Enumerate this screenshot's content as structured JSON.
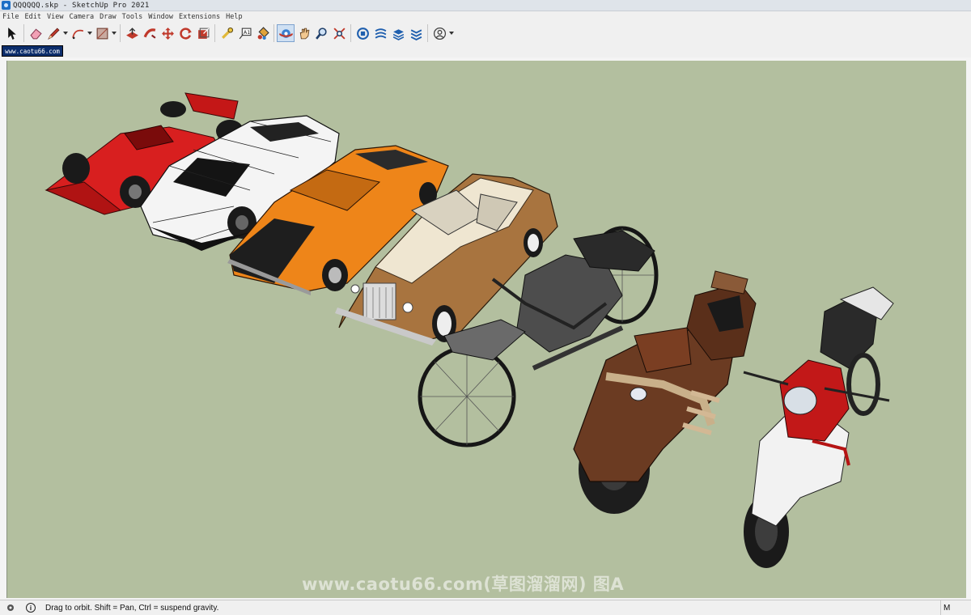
{
  "window": {
    "title": "QQQQQQ.skp - SketchUp Pro 2021"
  },
  "menu": [
    "File",
    "Edit",
    "View",
    "Camera",
    "Draw",
    "Tools",
    "Window",
    "Extensions",
    "Help"
  ],
  "toolbar": {
    "tools": [
      {
        "icon": "select-arrow-icon"
      },
      {
        "icon": "eraser-icon"
      },
      {
        "icon": "pencil-line-icon"
      },
      {
        "icon": "arc-icon"
      },
      {
        "icon": "rectangle-icon"
      },
      {
        "icon": "push-pull-icon"
      },
      {
        "icon": "follow-me-icon"
      },
      {
        "icon": "move-icon"
      },
      {
        "icon": "rotate-icon"
      },
      {
        "icon": "offset-icon"
      },
      {
        "icon": "tape-measure-icon"
      },
      {
        "icon": "text-icon"
      },
      {
        "icon": "paint-bucket-icon"
      },
      {
        "icon": "orbit-icon",
        "active": true
      },
      {
        "icon": "pan-icon"
      },
      {
        "icon": "zoom-icon"
      },
      {
        "icon": "zoom-extents-icon"
      },
      {
        "icon": "3d-warehouse-icon"
      },
      {
        "icon": "extension-warehouse-icon"
      },
      {
        "icon": "layout-icon"
      },
      {
        "icon": "extension-manager-icon"
      },
      {
        "icon": "account-icon"
      }
    ]
  },
  "scene_tab": {
    "label": "www.caotu66.com"
  },
  "watermark": "www.caotu66.com(草图溜溜网) 图A",
  "status": {
    "message": "Drag to orbit. Shift = Pan, Ctrl = suspend gravity.",
    "measurements_label": "M"
  },
  "colors": {
    "viewport_bg": "#b3bf9f",
    "tab_bg": "#0c2d6b",
    "accent_red": "#d81f1f",
    "accent_orange": "#ee8519"
  }
}
